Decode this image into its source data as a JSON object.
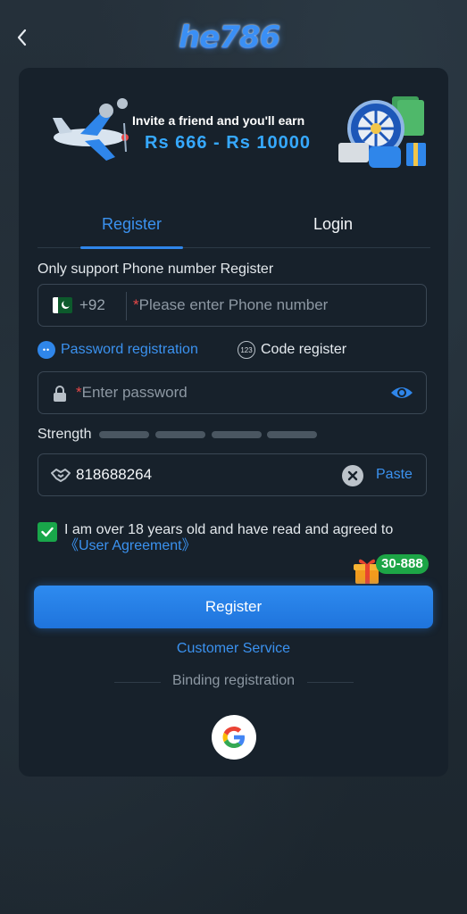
{
  "header": {
    "logo_text": "he786"
  },
  "banner": {
    "line1": "Invite a friend and you'll earn",
    "line2": "Rs 666 - Rs 10000"
  },
  "tabs": [
    {
      "label": "Register",
      "active": true
    },
    {
      "label": "Login",
      "active": false
    }
  ],
  "form": {
    "support_note": "Only support Phone number Register",
    "phone": {
      "country_code": "+92",
      "placeholder": "Please enter Phone number"
    },
    "modes": [
      {
        "label": "Password registration",
        "selected": true
      },
      {
        "label": "Code register",
        "selected": false
      }
    ],
    "password": {
      "placeholder": "Enter password"
    },
    "strength": {
      "label": "Strength",
      "level": 0,
      "segments": 4
    },
    "invite_code": {
      "value": "818688264",
      "paste_label": "Paste"
    },
    "agreement": {
      "checked": true,
      "text": "I am over 18 years old and have read and agreed to",
      "link": "《User Agreement》"
    }
  },
  "promo_badge": "30-888",
  "actions": {
    "register_label": "Register",
    "customer_service": "Customer Service",
    "binding_label": "Binding registration"
  },
  "colors": {
    "accent": "#2f86ea",
    "background": "#1f2a33",
    "card": "#17212b",
    "check": "#19a64a"
  }
}
